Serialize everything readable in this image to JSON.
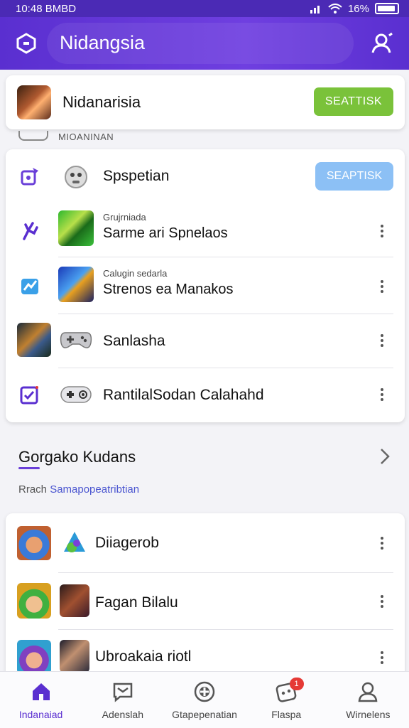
{
  "status_bar": {
    "time": "10:48 BMBD",
    "battery": "16%"
  },
  "app_bar": {
    "title": "Nidangsia"
  },
  "top_card": {
    "name": "Nidanarisia",
    "button_label": "SEATTISK"
  },
  "section_label": "MIOANINAN",
  "main_card": {
    "header": {
      "title": "Spspetian",
      "button_label": "SEAPTISK"
    },
    "rows": [
      {
        "subtitle": "Grujrniada",
        "title": "Sarme ari Spnelaos"
      },
      {
        "subtitle": "Calugin sedarla",
        "title": "Strenos ea Manakos"
      },
      {
        "title": "Sanlasha"
      },
      {
        "title": "RantilalSodan Calahahd"
      }
    ]
  },
  "section2": {
    "title": "Gorgako Kudans",
    "sub_prefix": "Rrach",
    "sub_link": "Samapopeatribtian"
  },
  "list_card": {
    "rows": [
      {
        "title": "Diiagerob"
      },
      {
        "title": "Fagan Bilalu"
      },
      {
        "title": "Ubroakaia riotl"
      }
    ]
  },
  "bottom_nav": [
    {
      "label": "Indanaiad",
      "icon": "home-icon",
      "active": true
    },
    {
      "label": "Adenslah",
      "icon": "message-icon",
      "active": false
    },
    {
      "label": "Gtapepenatian",
      "icon": "controller-icon",
      "active": false
    },
    {
      "label": "Flaspa",
      "icon": "gamepad-icon",
      "active": false,
      "badge": "1"
    },
    {
      "label": "Wirnelens",
      "icon": "person-icon",
      "active": false
    }
  ],
  "colors": {
    "accent": "#5a2fd0",
    "green_button": "#7ac23a",
    "blue_button": "#8cc0f5",
    "badge": "#e53935"
  }
}
